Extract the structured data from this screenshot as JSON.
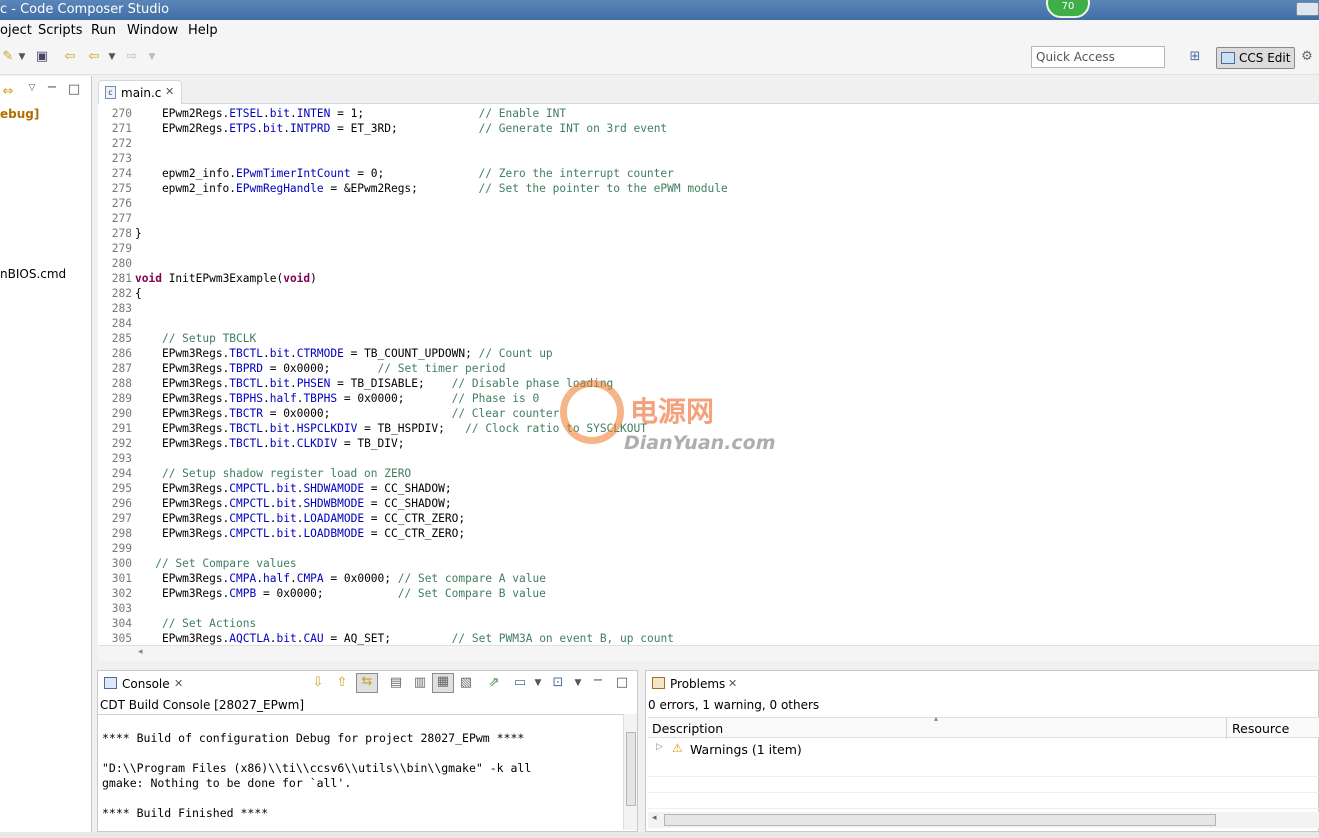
{
  "window": {
    "title": "c - Code Composer Studio",
    "badge": "70"
  },
  "menu": [
    "oject",
    "Scripts",
    "Run",
    "Window",
    "Help"
  ],
  "toolbar": {
    "quick_access_placeholder": "Quick Access",
    "perspective": "CCS Edit"
  },
  "left_pane": {
    "items": [
      "ebug]",
      "nBIOS.cmd"
    ]
  },
  "editor": {
    "tab": "main.c",
    "lines": [
      {
        "n": "270",
        "code": "    EPwm2Regs.ETSEL.bit.INTEN = 1;                 // Enable INT"
      },
      {
        "n": "271",
        "code": "    EPwm2Regs.ETPS.bit.INTPRD = ET_3RD;            // Generate INT on 3rd event"
      },
      {
        "n": "272",
        "code": ""
      },
      {
        "n": "273",
        "code": ""
      },
      {
        "n": "274",
        "code": "    epwm2_info.EPwmTimerIntCount = 0;              // Zero the interrupt counter"
      },
      {
        "n": "275",
        "code": "    epwm2_info.EPwmRegHandle = &EPwm2Regs;         // Set the pointer to the ePWM module"
      },
      {
        "n": "276",
        "code": ""
      },
      {
        "n": "277",
        "code": ""
      },
      {
        "n": "278",
        "code": "}"
      },
      {
        "n": "279",
        "code": ""
      },
      {
        "n": "280",
        "code": ""
      },
      {
        "n": "281",
        "code": "void InitEPwm3Example(void)"
      },
      {
        "n": "282",
        "code": "{"
      },
      {
        "n": "283",
        "code": ""
      },
      {
        "n": "284",
        "code": ""
      },
      {
        "n": "285",
        "code": "    // Setup TBCLK"
      },
      {
        "n": "286",
        "code": "    EPwm3Regs.TBCTL.bit.CTRMODE = TB_COUNT_UPDOWN; // Count up"
      },
      {
        "n": "287",
        "code": "    EPwm3Regs.TBPRD = 0x0000;       // Set timer period"
      },
      {
        "n": "288",
        "code": "    EPwm3Regs.TBCTL.bit.PHSEN = TB_DISABLE;    // Disable phase loading"
      },
      {
        "n": "289",
        "code": "    EPwm3Regs.TBPHS.half.TBPHS = 0x0000;       // Phase is 0"
      },
      {
        "n": "290",
        "code": "    EPwm3Regs.TBCTR = 0x0000;                  // Clear counter"
      },
      {
        "n": "291",
        "code": "    EPwm3Regs.TBCTL.bit.HSPCLKDIV = TB_HSPDIV;   // Clock ratio to SYSCLKOUT"
      },
      {
        "n": "292",
        "code": "    EPwm3Regs.TBCTL.bit.CLKDIV = TB_DIV;"
      },
      {
        "n": "293",
        "code": ""
      },
      {
        "n": "294",
        "code": "    // Setup shadow register load on ZERO"
      },
      {
        "n": "295",
        "code": "    EPwm3Regs.CMPCTL.bit.SHDWAMODE = CC_SHADOW;"
      },
      {
        "n": "296",
        "code": "    EPwm3Regs.CMPCTL.bit.SHDWBMODE = CC_SHADOW;"
      },
      {
        "n": "297",
        "code": "    EPwm3Regs.CMPCTL.bit.LOADAMODE = CC_CTR_ZERO;"
      },
      {
        "n": "298",
        "code": "    EPwm3Regs.CMPCTL.bit.LOADBMODE = CC_CTR_ZERO;"
      },
      {
        "n": "299",
        "code": ""
      },
      {
        "n": "300",
        "code": "   // Set Compare values"
      },
      {
        "n": "301",
        "code": "    EPwm3Regs.CMPA.half.CMPA = 0x0000; // Set compare A value"
      },
      {
        "n": "302",
        "code": "    EPwm3Regs.CMPB = 0x0000;           // Set Compare B value"
      },
      {
        "n": "303",
        "code": ""
      },
      {
        "n": "304",
        "code": "    // Set Actions"
      },
      {
        "n": "305",
        "code": "    EPwm3Regs.AQCTLA.bit.CAU = AQ_SET;         // Set PWM3A on event B, up count"
      }
    ]
  },
  "watermark": {
    "cn": "电源网",
    "en": "DianYuan.com"
  },
  "console": {
    "tab": "Console",
    "subtitle": "CDT Build Console [28027_EPwm]",
    "lines": [
      "**** Build of configuration Debug for project 28027_EPwm ****",
      "\"D:\\\\Program Files (x86)\\\\ti\\\\ccsv6\\\\utils\\\\bin\\\\gmake\" -k all",
      "gmake: Nothing to be done for `all'.",
      "**** Build Finished ****"
    ]
  },
  "problems": {
    "tab": "Problems",
    "summary": "0 errors, 1 warning, 0 others",
    "columns": [
      "Description",
      "Resource"
    ],
    "rows": [
      "Warnings (1 item)"
    ]
  }
}
